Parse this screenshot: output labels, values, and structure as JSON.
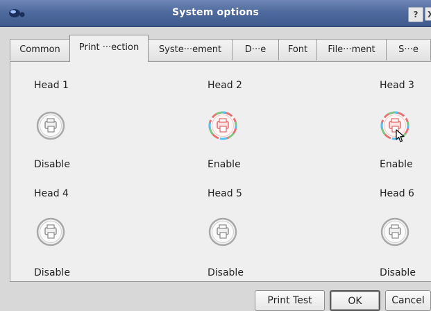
{
  "window": {
    "title": "System options",
    "help_label": "?",
    "close_label": "X"
  },
  "tabs": [
    {
      "label": "Common",
      "active": false
    },
    {
      "label": "Print ···ection",
      "active": true
    },
    {
      "label": "Syste···ement",
      "active": false
    },
    {
      "label": "D···e",
      "active": false
    },
    {
      "label": "Font",
      "active": false
    },
    {
      "label": "File···ment",
      "active": false
    },
    {
      "label": "S···e",
      "active": false
    }
  ],
  "heads": [
    {
      "label": "Head 1",
      "status": "Disable",
      "enabled": false
    },
    {
      "label": "Head 2",
      "status": "Enable",
      "enabled": true
    },
    {
      "label": "Head 3",
      "status": "Enable",
      "enabled": true
    },
    {
      "label": "Head 4",
      "status": "Disable",
      "enabled": false
    },
    {
      "label": "Head 5",
      "status": "Disable",
      "enabled": false
    },
    {
      "label": "Head 6",
      "status": "Disable",
      "enabled": false
    }
  ],
  "buttons": {
    "print_test": "Print Test",
    "ok": "OK",
    "cancel": "Cancel"
  },
  "colors": {
    "titlebar": "#4f6a9e",
    "enabled_ring": [
      "#4fc3f7",
      "#81c784",
      "#ffb74d",
      "#e57373",
      "#ba68c8"
    ],
    "disabled_ring": "#9e9e9e"
  }
}
